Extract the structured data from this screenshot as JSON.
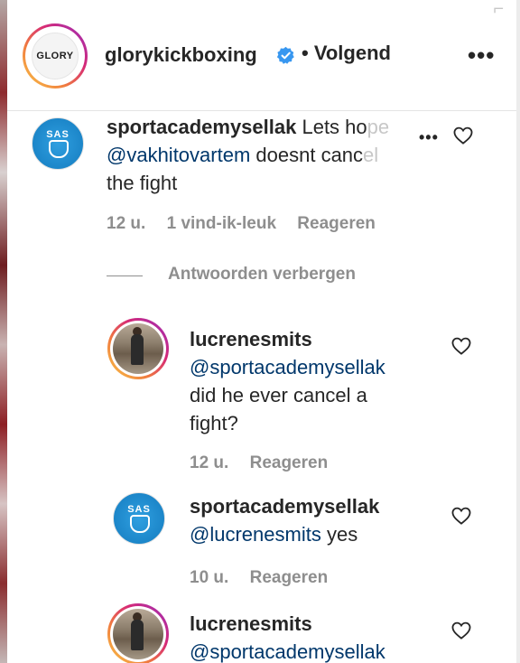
{
  "header": {
    "avatar_text": "GLORY",
    "username": "glorykickboxing",
    "follow_label": "• Volgend",
    "more_label": "•••",
    "close_glyph": "⌐"
  },
  "comments": [
    {
      "username": "sportacademysellak",
      "text_start": "Lets ho",
      "text_faded": "pe",
      "mention": "@vakhitovartem",
      "text_mid": "doesnt canc",
      "text_mid_faded": "el",
      "text_end": "the fight",
      "time": "12 u.",
      "likes": "1 vind-ik-leuk",
      "reply_label": "Reageren",
      "avatar_text": "SAS"
    }
  ],
  "hide_replies_label": "Antwoorden verbergen",
  "replies": [
    {
      "username": "lucrenesmits",
      "mention": "@sportacademysellak",
      "text_line1": "did he ever cancel a",
      "text_line2": "fight?",
      "time": "12 u.",
      "reply_label": "Reageren"
    },
    {
      "username": "sportacademysellak",
      "mention": "@lucrenesmits",
      "text": "yes",
      "time": "10 u.",
      "reply_label": "Reageren",
      "avatar_text": "SAS"
    },
    {
      "username": "lucrenesmits",
      "mention": "@sportacademysellak"
    }
  ],
  "icons": {
    "verified": "verified-badge-icon",
    "heart": "heart-outline-icon",
    "more": "more-dots-icon"
  },
  "colors": {
    "text": "#262626",
    "muted": "#8e8e8e",
    "mention": "#00376b",
    "verified": "#3897f0"
  }
}
